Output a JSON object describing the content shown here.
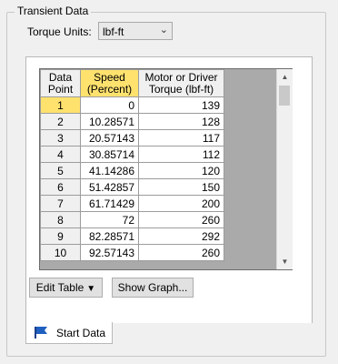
{
  "group_title": "Transient Data",
  "torque_units": {
    "label": "Torque Units:",
    "value": "lbf-ft"
  },
  "table": {
    "headers": {
      "row_header": [
        "Data",
        "Point"
      ],
      "col1": [
        "Speed",
        "(Percent)"
      ],
      "col2": [
        "Motor or Driver",
        "Torque (lbf-ft)"
      ]
    },
    "rows": [
      {
        "point": "1",
        "speed": "0",
        "torque": "139"
      },
      {
        "point": "2",
        "speed": "10.28571",
        "torque": "128"
      },
      {
        "point": "3",
        "speed": "20.57143",
        "torque": "117"
      },
      {
        "point": "4",
        "speed": "30.85714",
        "torque": "112"
      },
      {
        "point": "5",
        "speed": "41.14286",
        "torque": "120"
      },
      {
        "point": "6",
        "speed": "51.42857",
        "torque": "150"
      },
      {
        "point": "7",
        "speed": "61.71429",
        "torque": "200"
      },
      {
        "point": "8",
        "speed": "72",
        "torque": "260"
      },
      {
        "point": "9",
        "speed": "82.28571",
        "torque": "292"
      },
      {
        "point": "10",
        "speed": "92.57143",
        "torque": "260"
      }
    ]
  },
  "buttons": {
    "edit_table": "Edit Table",
    "show_graph": "Show Graph..."
  },
  "tab": {
    "label": "Start Data",
    "icon": "flag-icon"
  },
  "colors": {
    "selection": "#ffe26e",
    "flag": "#1f5fbf"
  }
}
